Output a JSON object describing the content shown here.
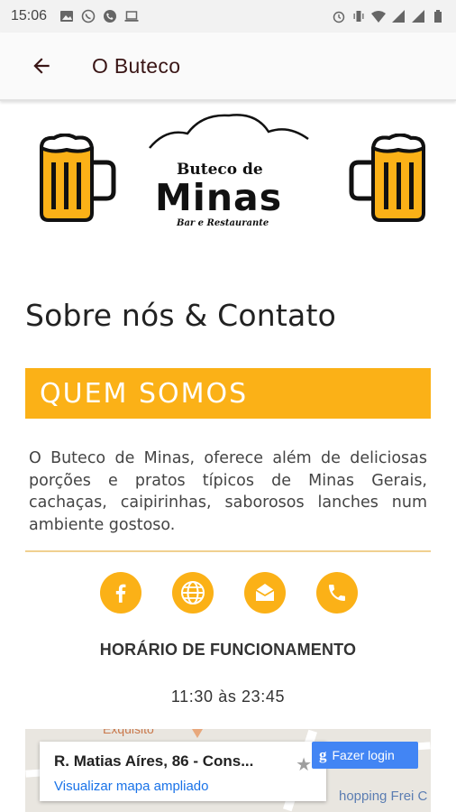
{
  "status_bar": {
    "time": "15:06",
    "left_icons": [
      "image-icon",
      "whatsapp-icon",
      "phone-call-icon",
      "laptop-icon"
    ],
    "right_icons": [
      "alarm-icon",
      "vibrate-icon",
      "wifi-icon",
      "signal-icon",
      "signal-icon",
      "battery-icon"
    ]
  },
  "app_bar": {
    "title": "O Buteco",
    "back_icon": "arrow-left-icon"
  },
  "logo": {
    "line1": "Buteco de",
    "line2": "Minas",
    "line3": "Bar e Restaurante",
    "left_icon": "beer-mug-icon",
    "right_icon": "beer-mug-icon"
  },
  "section": {
    "title": "Sobre nós & Contato"
  },
  "banner": {
    "title": "QUEM SOMOS"
  },
  "about": {
    "text": "O Buteco de Minas, oferece além de deliciosas porções e pratos típicos de Minas Gerais, cachaças, caipirinhas, saborosos lanches num ambiente gostoso."
  },
  "social": [
    {
      "icon": "facebook-icon"
    },
    {
      "icon": "globe-icon"
    },
    {
      "icon": "mail-icon"
    },
    {
      "icon": "phone-icon"
    }
  ],
  "hours": {
    "title": "HORÁRIO DE FUNCIONAMENTO",
    "value": "11:30 às 23:45"
  },
  "map": {
    "top_label": "Exquisito",
    "right_label": "hopping Frei C",
    "address": "R. Matias Aíres, 86 - Cons...",
    "link": "Visualizar mapa ampliado",
    "login_label": "Fazer login",
    "login_icon": "google-g-icon",
    "star_icon": "star-icon"
  },
  "colors": {
    "accent": "#fbb117",
    "title_dark": "#3a1616",
    "map_link": "#1a73e8",
    "google_blue": "#4285f4"
  }
}
